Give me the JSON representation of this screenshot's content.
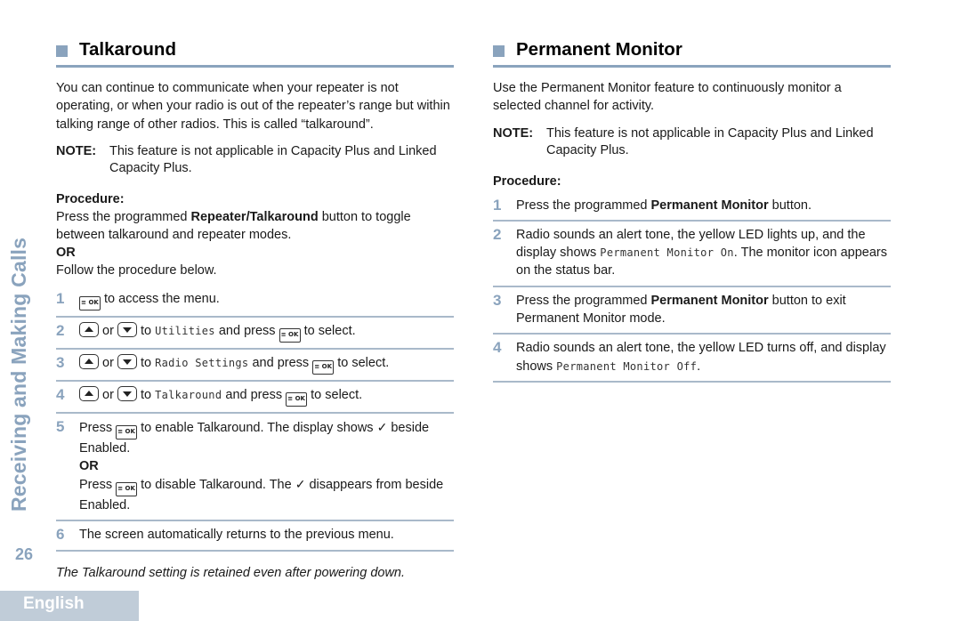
{
  "side": {
    "chapter_title": "Receiving and Making Calls",
    "page_number": "26",
    "language_tab": "English"
  },
  "icons": {
    "menu_ok_key": "menu-ok-key-icon",
    "up_key": "up-arrow-key-icon",
    "down_key": "down-arrow-key-icon",
    "checkmark": "✓",
    "section_marker": "square-bullet-icon"
  },
  "colors": {
    "accent": "#8aa3bd",
    "rule": "#a9b9ca",
    "lang_tab_bg": "#c0ccd8"
  },
  "talkaround": {
    "heading": "Talkaround",
    "intro": "You can continue to communicate when your repeater is not operating, or when your radio is out of the repeater’s range but within talking range of other radios. This is called “talkaround”.",
    "note_label": "NOTE:",
    "note_text": "This feature is not applicable in Capacity Plus and Linked Capacity Plus.",
    "procedure_label": "Procedure:",
    "proc_pre": "Press the programmed ",
    "proc_bold": "Repeater/Talkaround",
    "proc_post": " button to toggle between talkaround and repeater modes.",
    "or_label": "OR",
    "follow": "Follow the procedure below.",
    "key_text": "≡ OK",
    "or_word": " or ",
    "to_word": " to ",
    "and_press": " and press ",
    "to_select": " to select.",
    "steps": [
      {
        "num": "1",
        "text": " to access the menu."
      },
      {
        "num": "2",
        "menu": "Utilities"
      },
      {
        "num": "3",
        "menu": "Radio Settings"
      },
      {
        "num": "4",
        "menu": "Talkaround"
      },
      {
        "num": "5",
        "a_pre": "Press ",
        "a_post": " to enable Talkaround. The display shows ",
        "a_end": " beside Enabled.",
        "or": "OR",
        "b_pre": "Press ",
        "b_post": " to disable Talkaround. The ",
        "b_end": " disappears from beside Enabled."
      },
      {
        "num": "6",
        "text": "The screen automatically returns to the previous menu."
      }
    ],
    "footnote": "The Talkaround setting is retained even after powering down."
  },
  "permanent_monitor": {
    "heading": "Permanent Monitor",
    "intro": "Use the Permanent Monitor feature to continuously monitor a selected channel for activity.",
    "note_label": "NOTE:",
    "note_text": "This feature is not applicable in Capacity Plus and Linked Capacity Plus.",
    "procedure_label": "Procedure:",
    "steps": [
      {
        "num": "1",
        "pre": "Press the programmed ",
        "bold": "Permanent Monitor",
        "post": " button."
      },
      {
        "num": "2",
        "pre": "Radio sounds an alert tone, the yellow LED lights up, and the display shows ",
        "mono": "Permanent Monitor On",
        "post": ". The monitor icon appears on the status bar."
      },
      {
        "num": "3",
        "pre": "Press the programmed ",
        "bold": "Permanent Monitor",
        "post": " button to exit Permanent Monitor mode."
      },
      {
        "num": "4",
        "pre": "Radio sounds an alert tone, the yellow LED turns off, and display shows ",
        "mono": "Permanent Monitor Off",
        "post": "."
      }
    ]
  }
}
